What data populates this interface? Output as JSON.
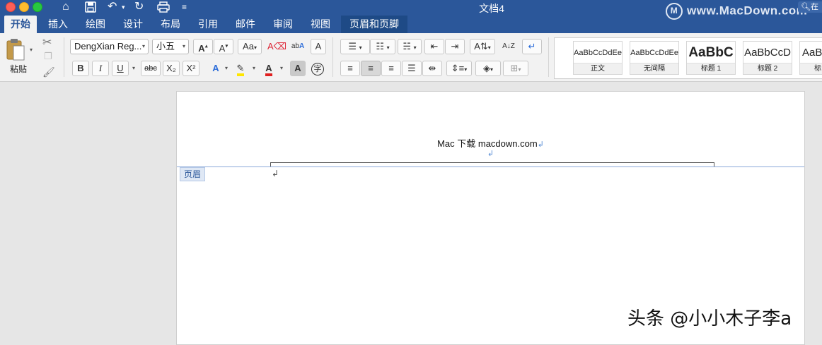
{
  "window": {
    "title": "文档4"
  },
  "watermark": {
    "text": "www.MacDown.com",
    "logo": "M"
  },
  "search": {
    "placeholder": "在"
  },
  "tabs": [
    "开始",
    "插入",
    "绘图",
    "设计",
    "布局",
    "引用",
    "邮件",
    "审阅",
    "视图",
    "页眉和页脚"
  ],
  "ribbon": {
    "paste_label": "粘贴",
    "font_name": "DengXian Reg...",
    "font_size": "小五",
    "bold": "B",
    "italic": "I",
    "underline": "U",
    "strike": "abc",
    "sub": "X₂",
    "sup": "X²",
    "styles": [
      {
        "sample": "AaBbCcDdEe",
        "name": "正文"
      },
      {
        "sample": "AaBbCcDdEe",
        "name": "无间隔"
      },
      {
        "sample": "AaBbC",
        "name": "标题 1"
      },
      {
        "sample": "AaBbCcD",
        "name": "标题 2"
      },
      {
        "sample": "AaBl",
        "name": "标"
      }
    ]
  },
  "document": {
    "header_text": "Mac 下载 macdown.com",
    "header_tab_label": "页眉",
    "paragraph_mark": "↲",
    "empty_mark": "↲"
  },
  "image_watermark": "头条 @小小木子李a",
  "colors": {
    "titlebar": "#2b579a",
    "accent": "#2b579a",
    "font_color": "#e02020",
    "highlight": "#ffe600"
  }
}
